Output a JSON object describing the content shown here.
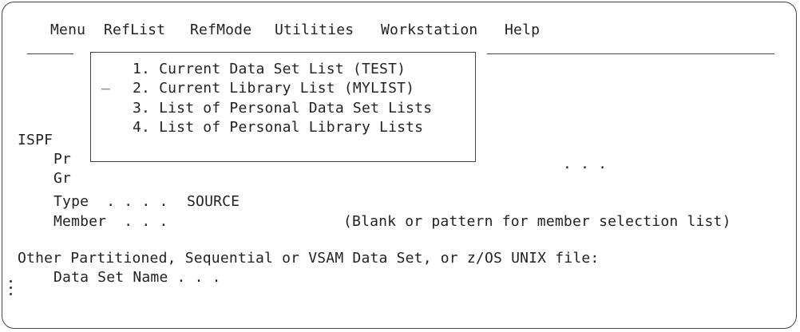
{
  "menubar": {
    "items": [
      "Menu",
      "RefList",
      "RefMode",
      "Utilities",
      "Workstation",
      "Help"
    ]
  },
  "popup": {
    "cursor": "_",
    "options": [
      "1. Current Data Set List (TEST)",
      "2. Current Library List (MYLIST)",
      "3. List of Personal Data Set Lists",
      "4. List of Personal Library Lists"
    ]
  },
  "panel": {
    "title_fragment": "ISPF",
    "project_fragment": "Pr",
    "group_fragment": "Gr",
    "group_dots": ". . .",
    "type_label": "Type  . . . .",
    "type_value": "SOURCE",
    "member_label": "Member  . . .",
    "member_hint": "(Blank or pattern for member selection list)",
    "other_heading": "Other Partitioned, Sequential or VSAM Data Set, or z/OS UNIX file:",
    "dsname_label": "Data Set Name . . ."
  }
}
